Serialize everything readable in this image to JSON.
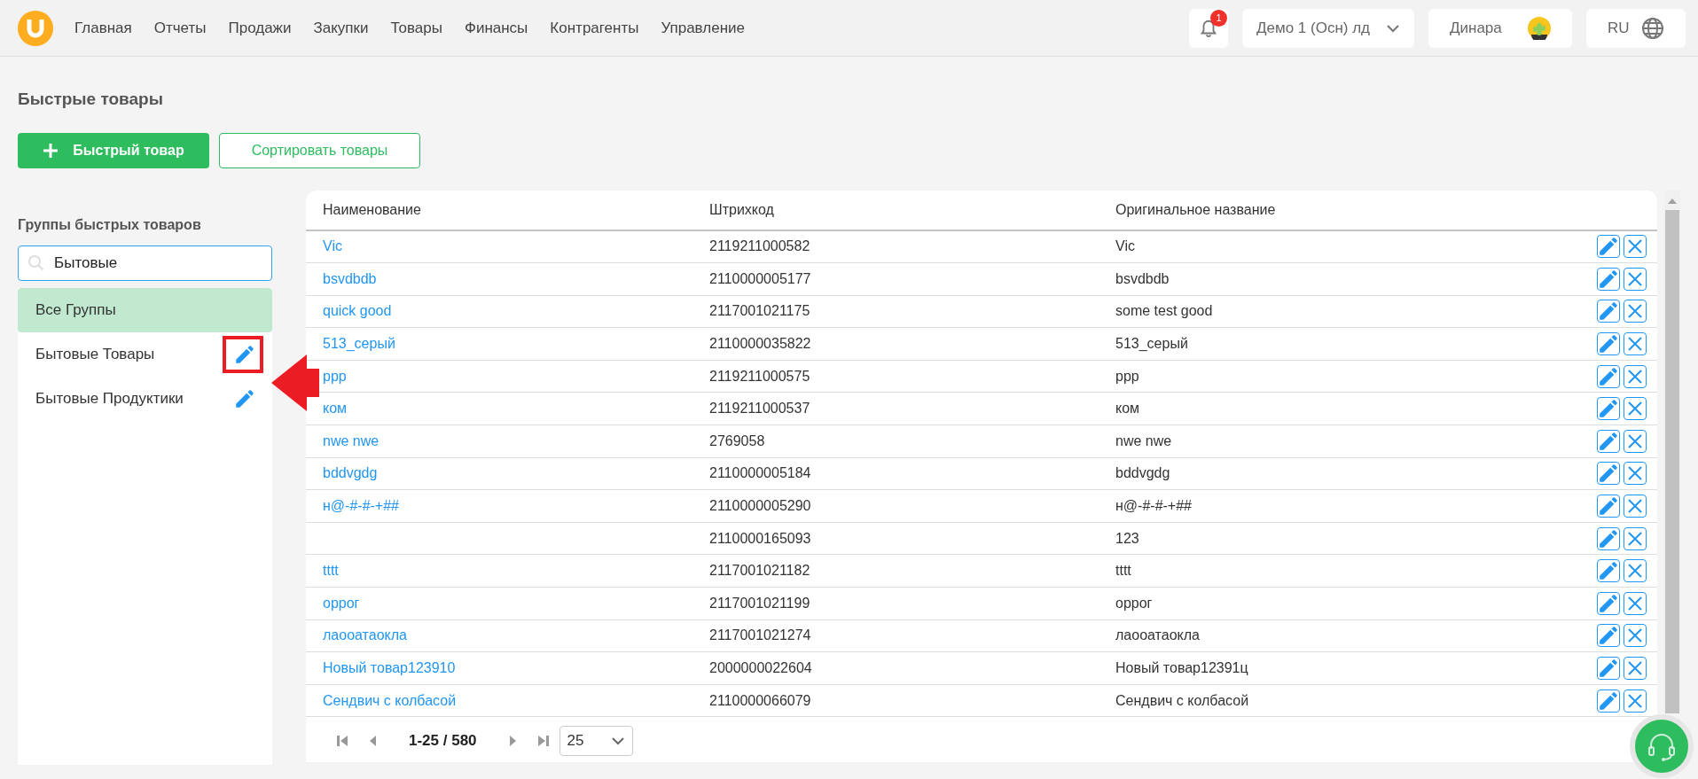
{
  "topbar": {
    "nav": [
      "Главная",
      "Отчеты",
      "Продажи",
      "Закупки",
      "Товары",
      "Финансы",
      "Контрагенты",
      "Управление"
    ],
    "notifications": {
      "count": "1"
    },
    "company": "Демо 1 (Осн) лд",
    "user": "Динара",
    "language": "RU"
  },
  "page": {
    "title": "Быстрые товары",
    "buttons": [
      {
        "kind": "primary",
        "label": "Быстрый товар"
      },
      {
        "kind": "outline",
        "label": "Сортировать товары"
      }
    ]
  },
  "groups": {
    "title": "Группы быстрых товаров",
    "search": {
      "value": "Бытовые"
    },
    "items": [
      {
        "label": "Все Группы",
        "selected": true,
        "editable": false,
        "highlighted": false
      },
      {
        "label": "Бытовые Товары",
        "selected": false,
        "editable": true,
        "highlighted": true
      },
      {
        "label": "Бытовые Продуктики",
        "selected": false,
        "editable": true,
        "highlighted": false
      }
    ]
  },
  "table": {
    "columns": [
      "Наименование",
      "Штрихкод",
      "Оригинальное название"
    ],
    "rows": [
      {
        "name": "Vic",
        "barcode": "2119211000582",
        "original": "Vic"
      },
      {
        "name": "bsvdbdb",
        "barcode": "2110000005177",
        "original": "bsvdbdb"
      },
      {
        "name": "quick good",
        "barcode": "2117001021175",
        "original": "some test good"
      },
      {
        "name": "513_серый",
        "barcode": "2110000035822",
        "original": "513_серый"
      },
      {
        "name": "ppp",
        "barcode": "2119211000575",
        "original": "ppp"
      },
      {
        "name": "ком",
        "barcode": "2119211000537",
        "original": "ком"
      },
      {
        "name": "nwe nwe",
        "barcode": "2769058",
        "original": "nwe nwe"
      },
      {
        "name": "bddvgdg",
        "barcode": "2110000005184",
        "original": "bddvgdg"
      },
      {
        "name": "н@-#-#-+##",
        "barcode": "2110000005290",
        "original": "н@-#-#-+##"
      },
      {
        "barcode": "2110000165093",
        "original": "123"
      },
      {
        "name": "tttt",
        "barcode": "2117001021182",
        "original": "tttt"
      },
      {
        "name": "оррог",
        "barcode": "2117001021199",
        "original": "оррог"
      },
      {
        "name": "лаооатаокла",
        "barcode": "2117001021274",
        "original": "лаооатаокла"
      },
      {
        "name": "Новый товар123910",
        "barcode": "2000000022604",
        "original": "Новый товар12391ц"
      },
      {
        "name": "Сендвич с колбасой",
        "barcode": "2110000066079",
        "original": "Сендвич с колбасой"
      }
    ],
    "pagination": {
      "range": "1-25 / 580",
      "page_size": "25"
    }
  }
}
